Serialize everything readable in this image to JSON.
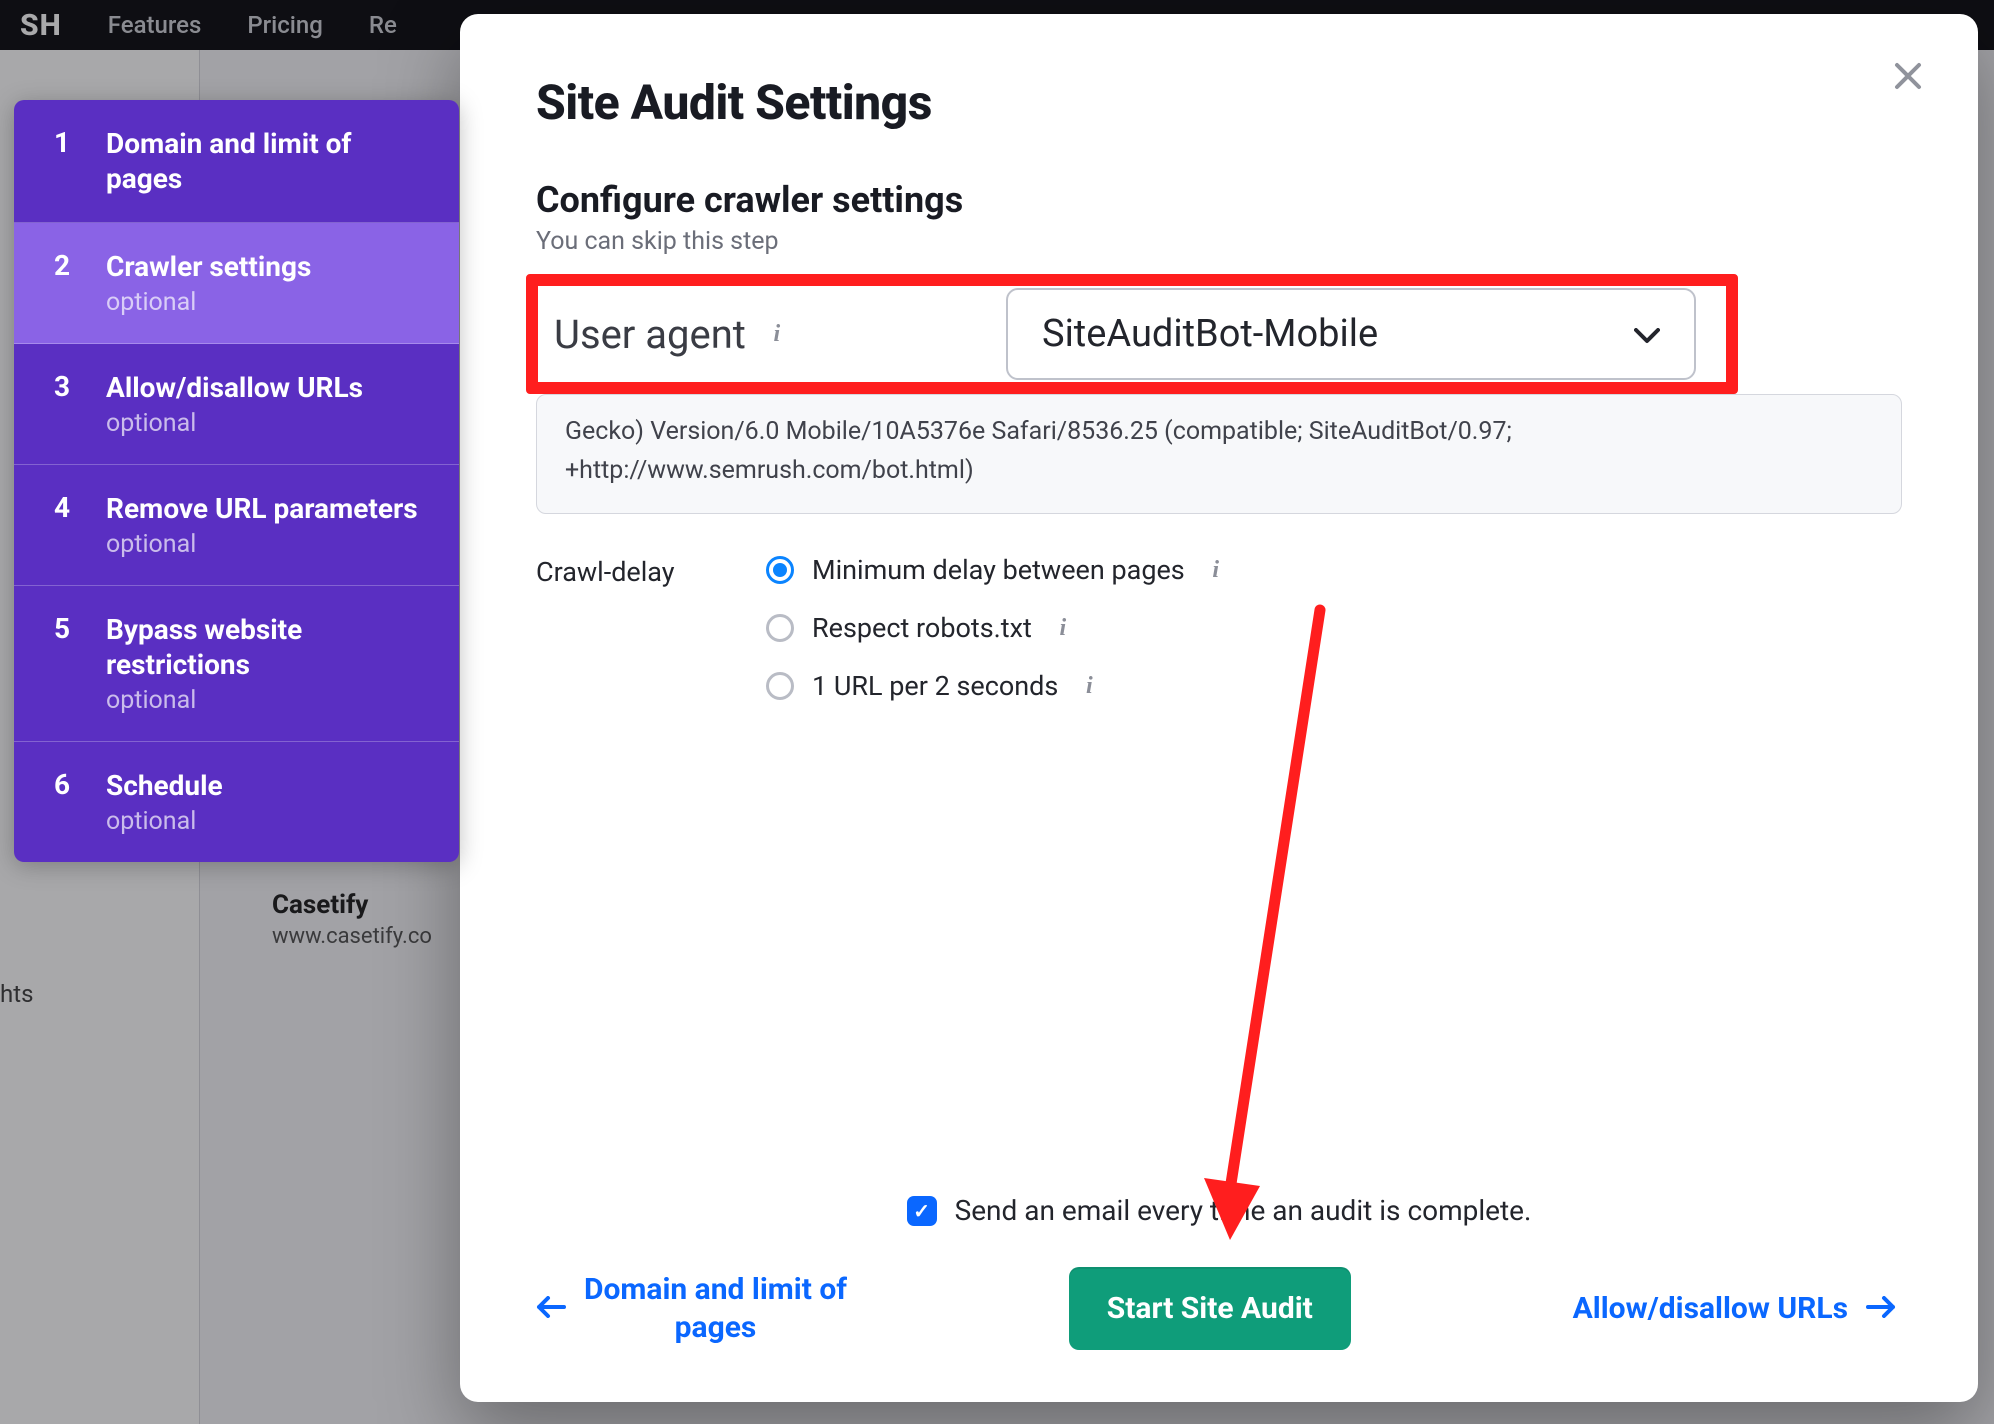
{
  "bg": {
    "topnav": {
      "logo_fragment": "SH",
      "items": [
        "Features",
        "Pricing",
        "Re"
      ]
    },
    "leftcol_fragment": "hts",
    "snippet": {
      "title": "Casetify",
      "url": "www.casetify.co"
    }
  },
  "wizard": {
    "steps": [
      {
        "num": "1",
        "title": "Domain and limit of pages",
        "optional": ""
      },
      {
        "num": "2",
        "title": "Crawler settings",
        "optional": "optional"
      },
      {
        "num": "3",
        "title": "Allow/disallow URLs",
        "optional": "optional"
      },
      {
        "num": "4",
        "title": "Remove URL parameters",
        "optional": "optional"
      },
      {
        "num": "5",
        "title": "Bypass website restrictions",
        "optional": "optional"
      },
      {
        "num": "6",
        "title": "Schedule",
        "optional": "optional"
      }
    ],
    "active_index": 1
  },
  "modal": {
    "title": "Site Audit Settings",
    "section_title": "Configure crawler settings",
    "skip_hint": "You can skip this step",
    "user_agent": {
      "label": "User agent",
      "selected": "SiteAuditBot-Mobile",
      "full_string_tail": "Gecko) Version/6.0 Mobile/10A5376e Safari/8536.25 (compatible; SiteAuditBot/0.97; +http://www.semrush.com/bot.html)"
    },
    "crawl_delay": {
      "label": "Crawl-delay",
      "options": [
        "Minimum delay between pages",
        "Respect robots.txt",
        "1 URL per 2 seconds"
      ],
      "selected_index": 0
    },
    "email_checkbox": {
      "checked": true,
      "label": "Send an email every time an audit is complete."
    },
    "nav": {
      "prev": "Domain and limit of pages",
      "start": "Start Site Audit",
      "next": "Allow/disallow URLs"
    }
  },
  "annotation": {
    "highlight_color": "#ff1e1e"
  }
}
